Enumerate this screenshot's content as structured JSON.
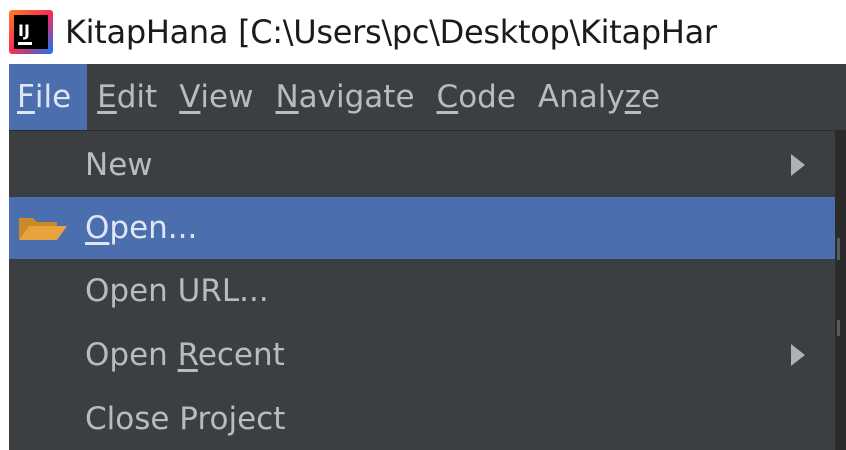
{
  "window": {
    "title": "KitapHana [C:\\Users\\pc\\Desktop\\KitapHar",
    "app_icon": "intellij-idea-icon",
    "app_icon_text": "IJ"
  },
  "menubar": {
    "items": [
      {
        "pre": "",
        "mnemonic": "F",
        "post": "ile",
        "active": true
      },
      {
        "pre": "",
        "mnemonic": "E",
        "post": "dit",
        "active": false
      },
      {
        "pre": "",
        "mnemonic": "V",
        "post": "iew",
        "active": false
      },
      {
        "pre": "",
        "mnemonic": "N",
        "post": "avigate",
        "active": false
      },
      {
        "pre": "",
        "mnemonic": "C",
        "post": "ode",
        "active": false
      },
      {
        "pre": "Analy",
        "mnemonic": "z",
        "post": "e",
        "active": false
      }
    ]
  },
  "file_menu": {
    "items": [
      {
        "pre": "New",
        "mnemonic": "",
        "post": "",
        "submenu": true,
        "selected": false,
        "icon": ""
      },
      {
        "pre": "",
        "mnemonic": "O",
        "post": "pen...",
        "submenu": false,
        "selected": true,
        "icon": "folder-open-icon"
      },
      {
        "pre": "Open URL...",
        "mnemonic": "",
        "post": "",
        "submenu": false,
        "selected": false,
        "icon": ""
      },
      {
        "pre": "Open ",
        "mnemonic": "R",
        "post": "ecent",
        "submenu": true,
        "selected": false,
        "icon": ""
      },
      {
        "pre": "Close Project",
        "mnemonic": "",
        "post": "",
        "submenu": false,
        "selected": false,
        "icon": ""
      }
    ]
  },
  "colors": {
    "menu_background": "#3c3f41",
    "selection": "#4b6eaf",
    "text": "#bbbbbb",
    "folder": "#e8a33d"
  }
}
